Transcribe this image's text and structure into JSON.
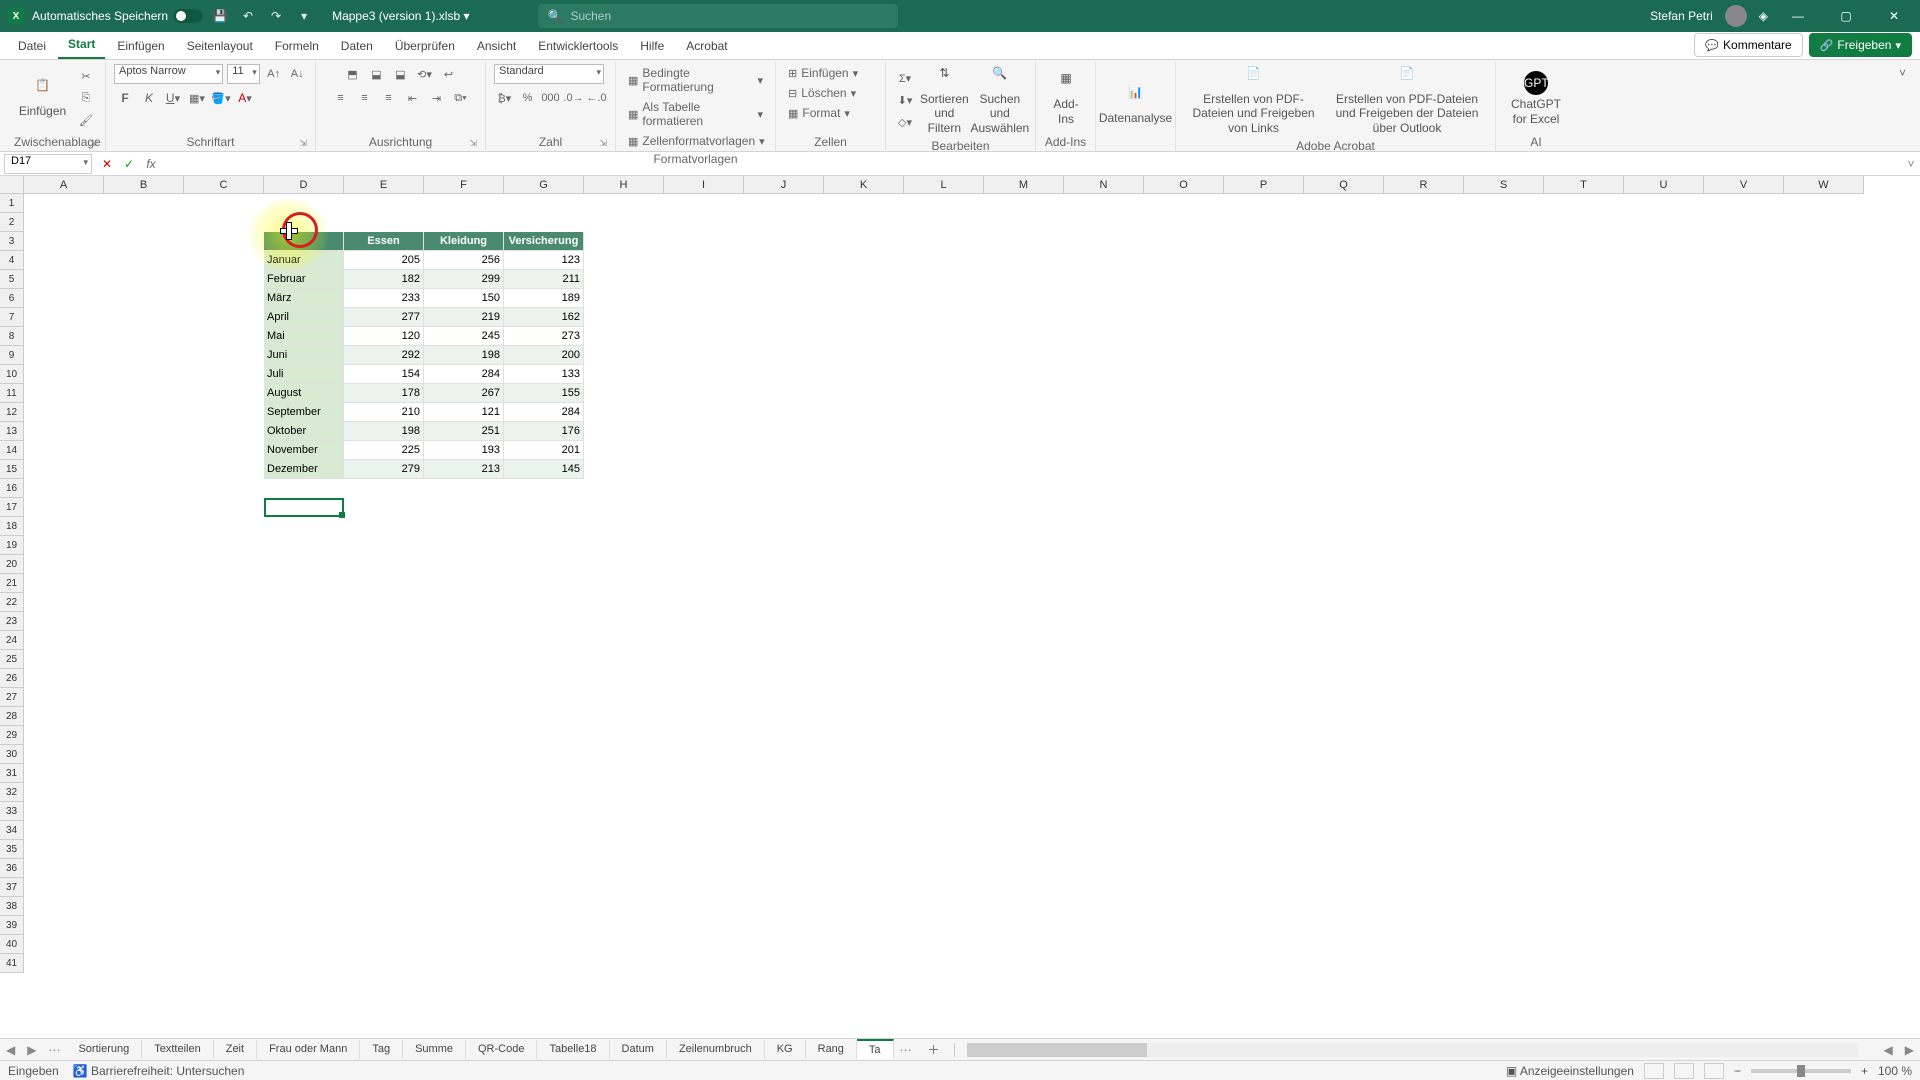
{
  "titlebar": {
    "autosave_label": "Automatisches Speichern",
    "filename": "Mappe3 (version 1).xlsb",
    "search_placeholder": "Suchen",
    "user": "Stefan Petri"
  },
  "tabs": {
    "items": [
      "Datei",
      "Start",
      "Einfügen",
      "Seitenlayout",
      "Formeln",
      "Daten",
      "Überprüfen",
      "Ansicht",
      "Entwicklertools",
      "Hilfe",
      "Acrobat"
    ],
    "active": 1,
    "comments": "Kommentare",
    "share": "Freigeben"
  },
  "ribbon": {
    "clipboard": {
      "label": "Zwischenablage",
      "paste": "Einfügen"
    },
    "font": {
      "label": "Schriftart",
      "name": "Aptos Narrow",
      "size": "11"
    },
    "align": {
      "label": "Ausrichtung"
    },
    "number": {
      "label": "Zahl",
      "format": "Standard"
    },
    "styles": {
      "label": "Formatvorlagen",
      "cond": "Bedingte Formatierung",
      "table": "Als Tabelle formatieren",
      "cell": "Zellenformatvorlagen"
    },
    "cells": {
      "label": "Zellen",
      "insert": "Einfügen",
      "delete": "Löschen",
      "format": "Format"
    },
    "editing": {
      "label": "Bearbeiten",
      "sort": "Sortieren und Filtern",
      "find": "Suchen und Auswählen"
    },
    "addins": {
      "label": "Add-Ins",
      "btn": "Add-Ins"
    },
    "analysis": {
      "label": "",
      "btn": "Datenanalyse"
    },
    "acrobat": {
      "label": "Adobe Acrobat",
      "pdf1": "Erstellen von PDF-Dateien und Freigeben von Links",
      "pdf2": "Erstellen von PDF-Dateien und Freigeben der Dateien über Outlook"
    },
    "ai": {
      "label": "AI",
      "gpt": "ChatGPT for Excel"
    }
  },
  "namebox": "D17",
  "cols": [
    "A",
    "B",
    "C",
    "D",
    "E",
    "F",
    "G",
    "H",
    "I",
    "J",
    "K",
    "L",
    "M",
    "N",
    "O",
    "P",
    "Q",
    "R",
    "S",
    "T",
    "U",
    "V",
    "W"
  ],
  "chart_data": {
    "type": "table",
    "headers": [
      "",
      "Essen",
      "Kleidung",
      "Versicherung"
    ],
    "rows": [
      [
        "Januar",
        205,
        256,
        123
      ],
      [
        "Februar",
        182,
        299,
        211
      ],
      [
        "März",
        233,
        150,
        189
      ],
      [
        "April",
        277,
        219,
        162
      ],
      [
        "Mai",
        120,
        245,
        273
      ],
      [
        "Juni",
        292,
        198,
        200
      ],
      [
        "Juli",
        154,
        284,
        133
      ],
      [
        "August",
        178,
        267,
        155
      ],
      [
        "September",
        210,
        121,
        284
      ],
      [
        "Oktober",
        198,
        251,
        176
      ],
      [
        "November",
        225,
        193,
        201
      ],
      [
        "Dezember",
        279,
        213,
        145
      ]
    ]
  },
  "sheets": {
    "items": [
      "Sortierung",
      "Textteilen",
      "Zeit",
      "Frau oder Mann",
      "Tag",
      "Summe",
      "QR-Code",
      "Tabelle18",
      "Datum",
      "Zeilenumbruch",
      "KG",
      "Rang",
      "Ta"
    ],
    "active": 12
  },
  "status": {
    "mode": "Eingeben",
    "access": "Barrierefreiheit: Untersuchen",
    "display": "Anzeigeeinstellungen",
    "zoom": "100 %"
  }
}
